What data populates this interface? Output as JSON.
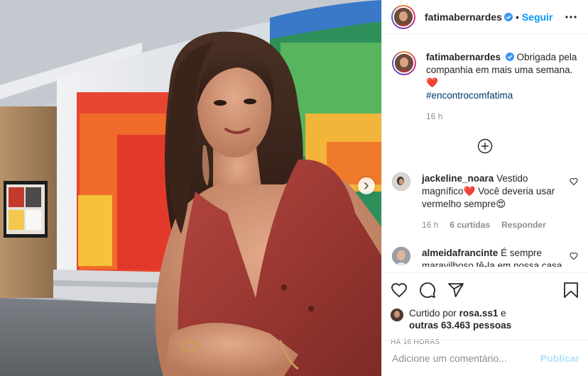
{
  "post": {
    "author": "fatimabernardes",
    "follow_label": "Seguir",
    "separator": "•"
  },
  "caption": {
    "username": "fatimabernardes",
    "text": "Obrigada pela companhia em mais uma semana. ❤️",
    "hashtag": "#encontrocomfatima",
    "time": "16 h"
  },
  "comments": [
    {
      "username": "jackeline_noara",
      "text": "Vestido magnífico❤️ Você deveria usar vermelho sempre😍",
      "time": "16 h",
      "likes": "6 curtidas",
      "reply": "Responder"
    },
    {
      "username": "almeidafrancinte",
      "text": "É sempre maravilhoso tê-la em nossa casa todas as manhãs😍😍😍"
    }
  ],
  "likes": {
    "prefix": "Curtido por",
    "first_user": "rosa.ss1",
    "connector": "e",
    "others": "outras 63.463 pessoas"
  },
  "timestamp": "HÁ 16 HORAS",
  "add_comment": {
    "placeholder": "Adicione um comentário...",
    "publish_label": "Publicar"
  },
  "colors": {
    "link": "#0095f6",
    "publish_disabled": "#b2dffc",
    "hashtag": "#00376b",
    "muted": "#8e8e8e"
  },
  "icons": {
    "header": [
      "verified-badge-icon",
      "more-options-icon"
    ],
    "media": [
      "chevron-right-icon"
    ],
    "actions": [
      "heart-icon",
      "comment-icon",
      "share-icon",
      "bookmark-icon"
    ],
    "comments": [
      "load-more-icon",
      "comment-heart-icon"
    ]
  }
}
